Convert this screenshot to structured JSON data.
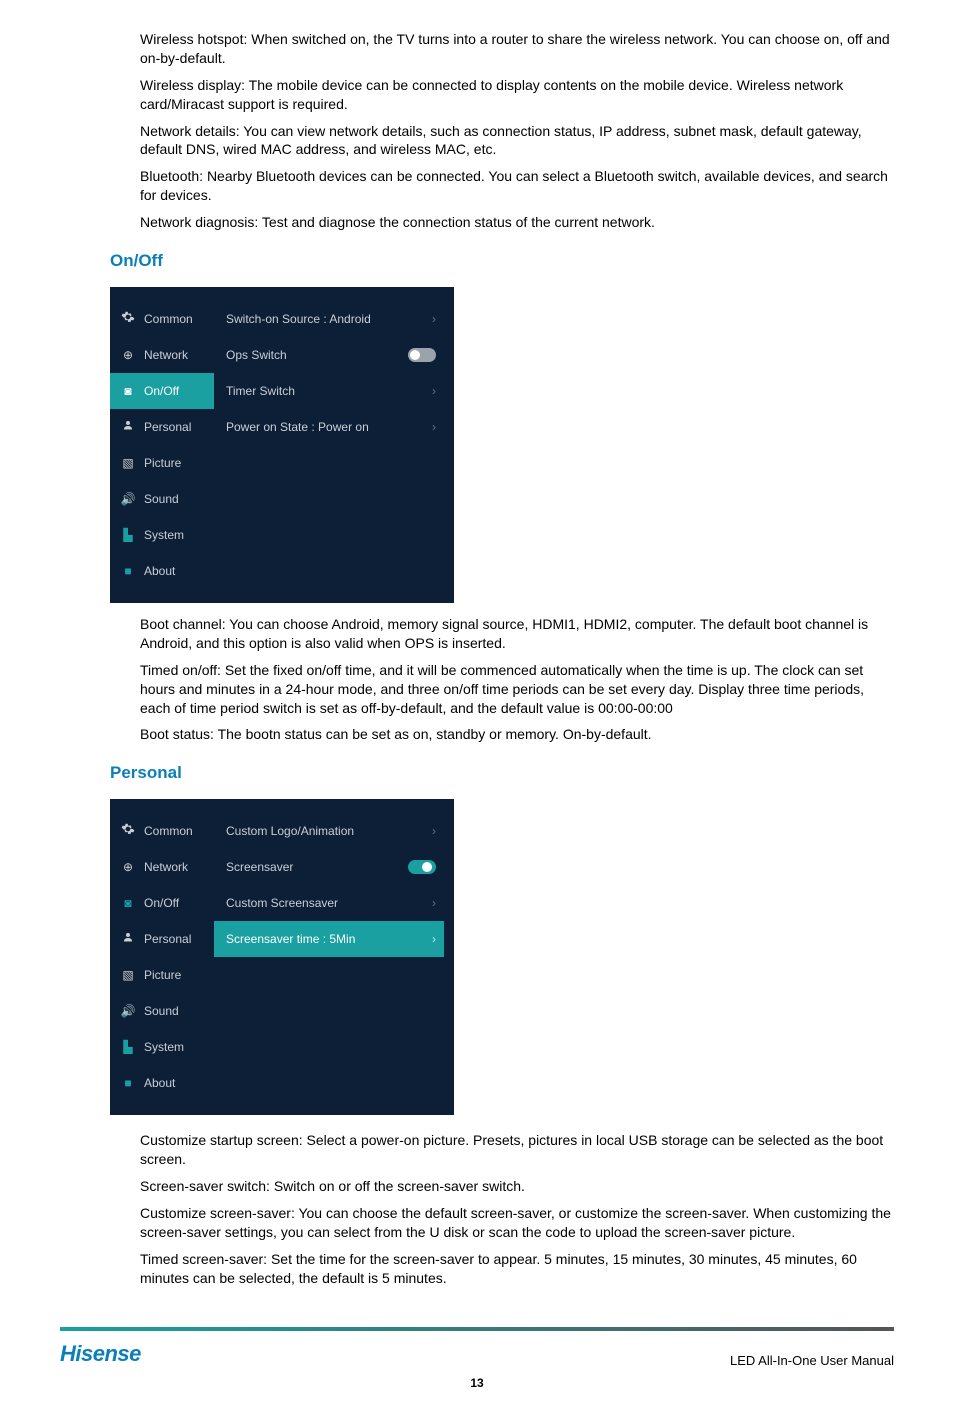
{
  "intro_paras": [
    "Wireless hotspot: When switched on, the TV turns into a router to share the wireless network. You can choose on, off and on-by-default.",
    "Wireless display: The mobile device can be connected to display contents on the mobile device. Wireless network card/Miracast support is required.",
    "Network details: You can view network details, such as connection status, IP address, subnet mask, default gateway, default DNS, wired MAC address, and wireless MAC, etc.",
    "Bluetooth: Nearby Bluetooth devices can be connected. You can select a Bluetooth switch, available devices, and search for devices.",
    "Network diagnosis: Test and diagnose the connection status of the current network."
  ],
  "onoff": {
    "title": "On/Off",
    "sidebar": [
      "Common",
      "Network",
      "On/Off",
      "Personal",
      "Picture",
      "Sound",
      "System",
      "About"
    ],
    "rows": [
      {
        "label": "Switch-on Source :   Android",
        "type": "arrow"
      },
      {
        "label": "Ops Switch",
        "type": "toggle_off"
      },
      {
        "label": "Timer Switch",
        "type": "arrow"
      },
      {
        "label": "Power on State :   Power on",
        "type": "arrow"
      }
    ],
    "selected_index": 2,
    "paras": [
      "Boot channel: You can choose Android, memory signal source, HDMI1, HDMI2, computer. The default boot channel is Android, and this option is also valid when OPS is inserted.",
      "Timed on/off: Set the fixed on/off time, and it will be commenced automatically when the time is up. The clock can set hours and minutes in a 24-hour mode, and three on/off time periods can be set every day. Display three time periods, each of time period switch is set as off-by-default, and the default value is 00:00-00:00",
      "Boot status: The bootn status can be set as on, standby or memory. On-by-default."
    ]
  },
  "personal": {
    "title": "Personal",
    "sidebar": [
      "Common",
      "Network",
      "On/Off",
      "Personal",
      "Picture",
      "Sound",
      "System",
      "About"
    ],
    "rows": [
      {
        "label": "Custom Logo/Animation",
        "type": "arrow"
      },
      {
        "label": "Screensaver",
        "type": "toggle_on"
      },
      {
        "label": "Custom Screensaver",
        "type": "arrow"
      },
      {
        "label": "Screensaver time :    5Min",
        "type": "arrow_teal"
      }
    ],
    "selected_index": 3,
    "paras": [
      "Customize startup screen: Select a power-on picture. Presets, pictures in local USB storage can be selected as the boot screen.",
      "Screen-saver switch: Switch on or off the screen-saver switch.",
      "Customize screen-saver: You can choose the default screen-saver, or customize the screen-saver. When customizing the screen-saver settings, you can select from the U disk or scan the code to upload the screen-saver picture.",
      "Timed screen-saver: Set the time for the screen-saver to appear. 5 minutes, 15 minutes, 30 minutes, 45 minutes, 60 minutes can be selected, the default is 5 minutes."
    ]
  },
  "icons": [
    "✿",
    "⊕",
    "◙",
    "◆",
    "▧",
    "🔊",
    "▙",
    "■"
  ],
  "footer": {
    "brand": "Hisense",
    "doc": "LED All-In-One User Manual",
    "page": "13"
  }
}
